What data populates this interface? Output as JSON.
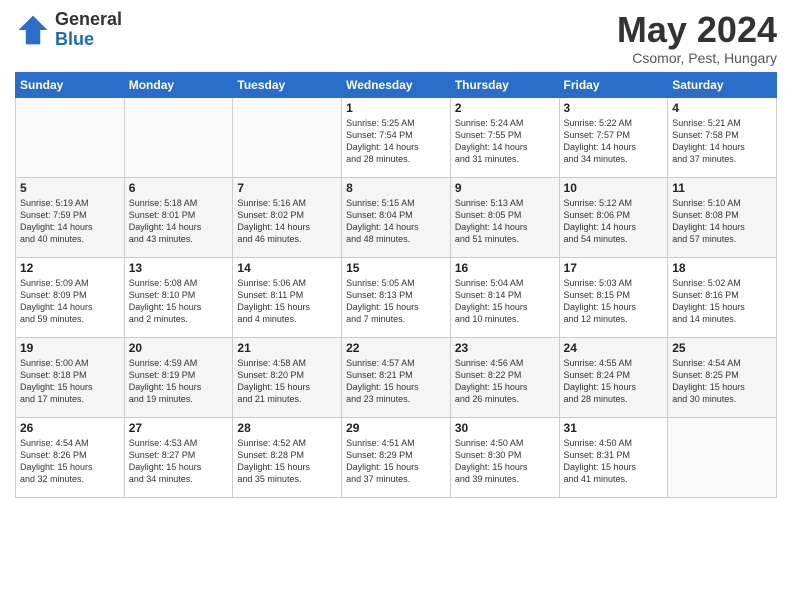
{
  "header": {
    "logo_general": "General",
    "logo_blue": "Blue",
    "title": "May 2024",
    "subtitle": "Csomor, Pest, Hungary"
  },
  "days_of_week": [
    "Sunday",
    "Monday",
    "Tuesday",
    "Wednesday",
    "Thursday",
    "Friday",
    "Saturday"
  ],
  "weeks": [
    [
      {
        "day": "",
        "info": ""
      },
      {
        "day": "",
        "info": ""
      },
      {
        "day": "",
        "info": ""
      },
      {
        "day": "1",
        "info": "Sunrise: 5:25 AM\nSunset: 7:54 PM\nDaylight: 14 hours\nand 28 minutes."
      },
      {
        "day": "2",
        "info": "Sunrise: 5:24 AM\nSunset: 7:55 PM\nDaylight: 14 hours\nand 31 minutes."
      },
      {
        "day": "3",
        "info": "Sunrise: 5:22 AM\nSunset: 7:57 PM\nDaylight: 14 hours\nand 34 minutes."
      },
      {
        "day": "4",
        "info": "Sunrise: 5:21 AM\nSunset: 7:58 PM\nDaylight: 14 hours\nand 37 minutes."
      }
    ],
    [
      {
        "day": "5",
        "info": "Sunrise: 5:19 AM\nSunset: 7:59 PM\nDaylight: 14 hours\nand 40 minutes."
      },
      {
        "day": "6",
        "info": "Sunrise: 5:18 AM\nSunset: 8:01 PM\nDaylight: 14 hours\nand 43 minutes."
      },
      {
        "day": "7",
        "info": "Sunrise: 5:16 AM\nSunset: 8:02 PM\nDaylight: 14 hours\nand 46 minutes."
      },
      {
        "day": "8",
        "info": "Sunrise: 5:15 AM\nSunset: 8:04 PM\nDaylight: 14 hours\nand 48 minutes."
      },
      {
        "day": "9",
        "info": "Sunrise: 5:13 AM\nSunset: 8:05 PM\nDaylight: 14 hours\nand 51 minutes."
      },
      {
        "day": "10",
        "info": "Sunrise: 5:12 AM\nSunset: 8:06 PM\nDaylight: 14 hours\nand 54 minutes."
      },
      {
        "day": "11",
        "info": "Sunrise: 5:10 AM\nSunset: 8:08 PM\nDaylight: 14 hours\nand 57 minutes."
      }
    ],
    [
      {
        "day": "12",
        "info": "Sunrise: 5:09 AM\nSunset: 8:09 PM\nDaylight: 14 hours\nand 59 minutes."
      },
      {
        "day": "13",
        "info": "Sunrise: 5:08 AM\nSunset: 8:10 PM\nDaylight: 15 hours\nand 2 minutes."
      },
      {
        "day": "14",
        "info": "Sunrise: 5:06 AM\nSunset: 8:11 PM\nDaylight: 15 hours\nand 4 minutes."
      },
      {
        "day": "15",
        "info": "Sunrise: 5:05 AM\nSunset: 8:13 PM\nDaylight: 15 hours\nand 7 minutes."
      },
      {
        "day": "16",
        "info": "Sunrise: 5:04 AM\nSunset: 8:14 PM\nDaylight: 15 hours\nand 10 minutes."
      },
      {
        "day": "17",
        "info": "Sunrise: 5:03 AM\nSunset: 8:15 PM\nDaylight: 15 hours\nand 12 minutes."
      },
      {
        "day": "18",
        "info": "Sunrise: 5:02 AM\nSunset: 8:16 PM\nDaylight: 15 hours\nand 14 minutes."
      }
    ],
    [
      {
        "day": "19",
        "info": "Sunrise: 5:00 AM\nSunset: 8:18 PM\nDaylight: 15 hours\nand 17 minutes."
      },
      {
        "day": "20",
        "info": "Sunrise: 4:59 AM\nSunset: 8:19 PM\nDaylight: 15 hours\nand 19 minutes."
      },
      {
        "day": "21",
        "info": "Sunrise: 4:58 AM\nSunset: 8:20 PM\nDaylight: 15 hours\nand 21 minutes."
      },
      {
        "day": "22",
        "info": "Sunrise: 4:57 AM\nSunset: 8:21 PM\nDaylight: 15 hours\nand 23 minutes."
      },
      {
        "day": "23",
        "info": "Sunrise: 4:56 AM\nSunset: 8:22 PM\nDaylight: 15 hours\nand 26 minutes."
      },
      {
        "day": "24",
        "info": "Sunrise: 4:55 AM\nSunset: 8:24 PM\nDaylight: 15 hours\nand 28 minutes."
      },
      {
        "day": "25",
        "info": "Sunrise: 4:54 AM\nSunset: 8:25 PM\nDaylight: 15 hours\nand 30 minutes."
      }
    ],
    [
      {
        "day": "26",
        "info": "Sunrise: 4:54 AM\nSunset: 8:26 PM\nDaylight: 15 hours\nand 32 minutes."
      },
      {
        "day": "27",
        "info": "Sunrise: 4:53 AM\nSunset: 8:27 PM\nDaylight: 15 hours\nand 34 minutes."
      },
      {
        "day": "28",
        "info": "Sunrise: 4:52 AM\nSunset: 8:28 PM\nDaylight: 15 hours\nand 35 minutes."
      },
      {
        "day": "29",
        "info": "Sunrise: 4:51 AM\nSunset: 8:29 PM\nDaylight: 15 hours\nand 37 minutes."
      },
      {
        "day": "30",
        "info": "Sunrise: 4:50 AM\nSunset: 8:30 PM\nDaylight: 15 hours\nand 39 minutes."
      },
      {
        "day": "31",
        "info": "Sunrise: 4:50 AM\nSunset: 8:31 PM\nDaylight: 15 hours\nand 41 minutes."
      },
      {
        "day": "",
        "info": ""
      }
    ]
  ]
}
